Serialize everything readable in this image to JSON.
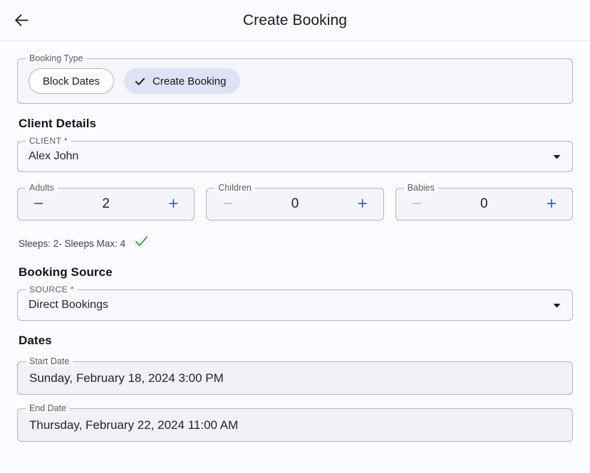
{
  "header": {
    "back_icon": "arrow-left-icon",
    "title": "Create Booking"
  },
  "booking_type": {
    "legend": "Booking Type",
    "options": [
      {
        "label": "Block Dates",
        "selected": false
      },
      {
        "label": "Create Booking",
        "selected": true,
        "icon": "check-icon"
      }
    ]
  },
  "client_details": {
    "section_title": "Client Details",
    "client_select": {
      "legend": "CLIENT *",
      "value": "Alex John",
      "caret_icon": "chevron-down-icon"
    },
    "steppers": [
      {
        "legend": "Adults",
        "value": "2",
        "minus": "−",
        "plus": "+",
        "minus_enabled": true
      },
      {
        "legend": "Children",
        "value": "0",
        "minus": "−",
        "plus": "+",
        "minus_enabled": false
      },
      {
        "legend": "Babies",
        "value": "0",
        "minus": "−",
        "plus": "+",
        "minus_enabled": false
      }
    ],
    "sleeps_text": "Sleeps: 2- Sleeps Max: 4",
    "sleeps_status_icon": "check-mark-green-icon"
  },
  "booking_source": {
    "section_title": "Booking Source",
    "source_select": {
      "legend": "SOURCE *",
      "value": "Direct Bookings",
      "caret_icon": "chevron-down-icon"
    }
  },
  "dates": {
    "section_title": "Dates",
    "start_date": {
      "legend": "Start Date",
      "value": "Sunday, February 18, 2024 3:00 PM"
    },
    "end_date": {
      "legend": "End Date",
      "value": "Thursday, February 22, 2024 11:00 AM"
    }
  },
  "colors": {
    "page_bg": "#fcfbff",
    "selected_chip_bg": "#dee2f5",
    "accent_blue": "#3860c4",
    "success_green": "#3aaa35",
    "border_grey": "#b6b3c0"
  }
}
